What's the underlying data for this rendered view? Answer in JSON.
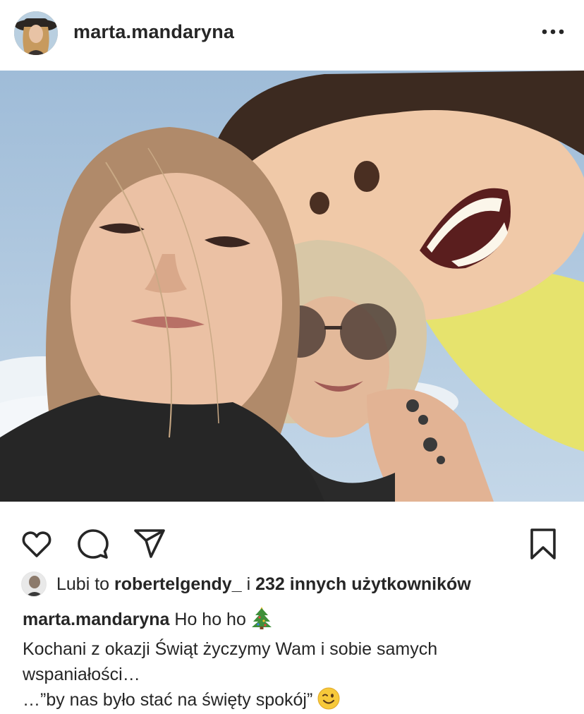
{
  "post": {
    "username": "marta.mandaryna",
    "more_icon": "more-horizontal-icon"
  },
  "actions": {
    "like_icon": "heart-icon",
    "comment_icon": "comment-icon",
    "share_icon": "send-icon",
    "save_icon": "bookmark-icon"
  },
  "likes": {
    "prefix": "Lubi to",
    "user": "robertelgendy_",
    "conjunction": "i",
    "count_text": "232 innych użytkowników"
  },
  "caption": {
    "username": "marta.mandaryna",
    "line1": "Ho ho ho",
    "line2": "Kochani z okazji Świąt życzymy Wam i sobie samych",
    "line3": "wspaniałości…",
    "line4": "…”by nas było stać na święty spokój”",
    "emoji1": "christmas-tree-icon",
    "emoji2": "winking-face-icon"
  },
  "colors": {
    "text": "#262626",
    "sky": "#a9c6e0",
    "shirt_yellow": "#e8e46a"
  }
}
